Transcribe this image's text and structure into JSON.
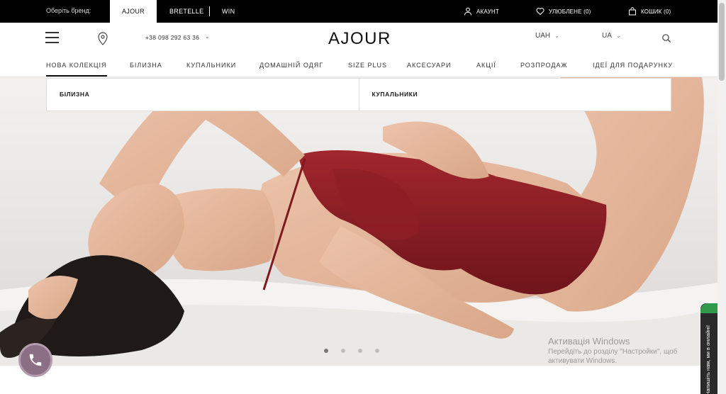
{
  "topbar": {
    "brand_label": "Оберіть бренд:",
    "brands": [
      "AJOUR",
      "BRETELLE",
      "WIN"
    ],
    "account": "Акаунт",
    "favorites": "Улюблене (0)",
    "cart": "Кошик (0)"
  },
  "header": {
    "phone": "+38 098 292 63 36",
    "logo": "AJOUR",
    "currency": "UAH",
    "language": "UA"
  },
  "nav": {
    "items": [
      "Нова колекція",
      "Білизна",
      "Купальники",
      "Домашній одяг",
      "Size Plus",
      "Аксесуари",
      "Акції",
      "Розпродаж",
      "Ідеї для подарунку"
    ]
  },
  "dropdown": {
    "columns": [
      "Білизна",
      "Купальники"
    ]
  },
  "hero": {
    "slide_count": 4,
    "active_slide": 1
  },
  "chat": {
    "label": "Напишіть нам, ми в онлайні!"
  },
  "watermark": {
    "line1": "Активація Windows",
    "line2": "Перейдіть до розділу \"Настройки\", щоб",
    "line3": "активувати Windows."
  },
  "colors": {
    "topbar": "#000000",
    "accent_call": "#8b6f84",
    "chat_green": "#2e9a4a",
    "bodysuit": "#8e1c22"
  }
}
